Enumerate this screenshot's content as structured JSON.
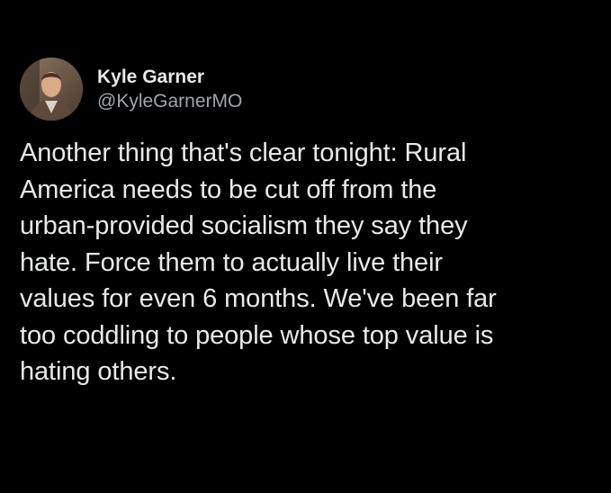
{
  "author": {
    "display_name": "Kyle Garner",
    "handle": "@KyleGarnerMO",
    "avatar_icon": "profile-photo"
  },
  "tweet": {
    "text": "Another thing that's clear tonight: Rural\nAmerica needs to be cut off from the\nurban-provided socialism they say they\nhate. Force them to actually live their\nvalues for even 6 months. We've been far\ntoo coddling to people whose top value is\nhating others."
  },
  "colors": {
    "background": "#000000",
    "primary_text": "#e7e9ea",
    "secondary_text": "#a0a6ab"
  }
}
